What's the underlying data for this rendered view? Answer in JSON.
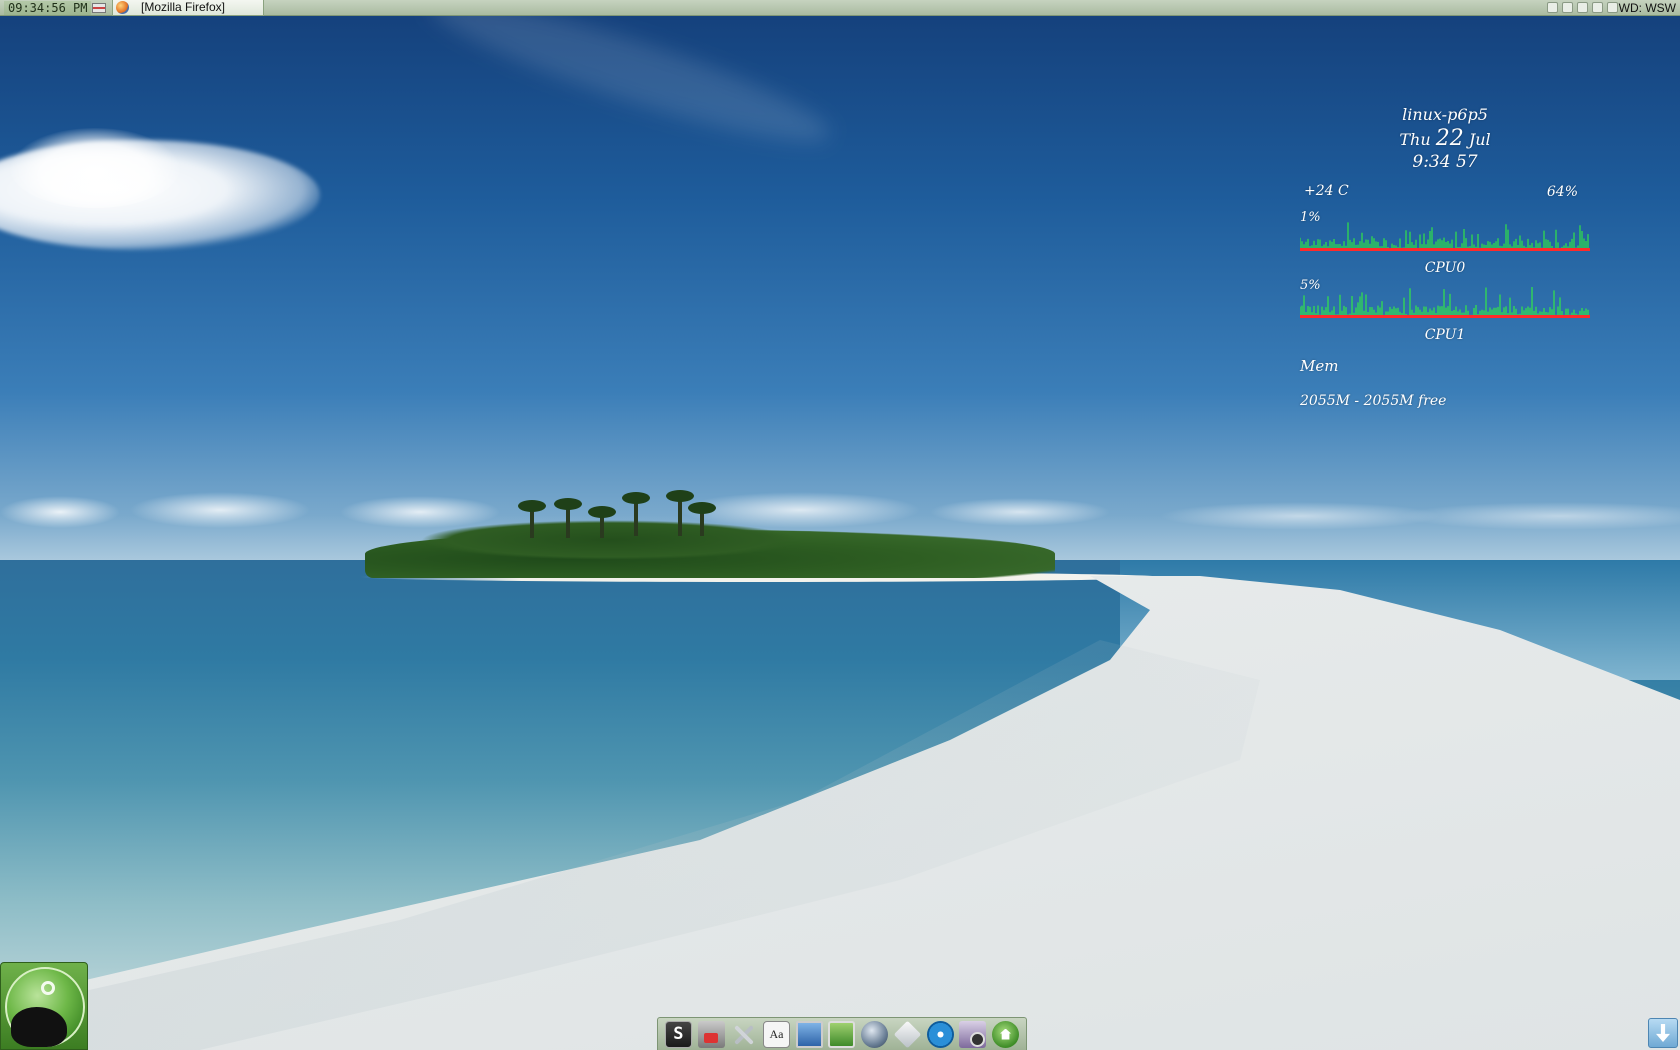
{
  "top_panel": {
    "clock": "09:34:56 PM",
    "taskbar": [
      {
        "label": "[Mozilla Firefox]",
        "icon": "firefox-icon"
      }
    ],
    "tray_icons": [
      "window-icon",
      "volume-icon",
      "network-icon",
      "battery-icon",
      "update-icon"
    ],
    "workspace": "WD: WSW"
  },
  "conky": {
    "hostname": "linux-p6p5",
    "date": {
      "weekday": "Thu",
      "day": "22",
      "month": "Jul"
    },
    "time": "9:34 57",
    "temperature": "+24 C",
    "battery": "64%",
    "cpu0": {
      "label": "CPU0",
      "percent": "1%"
    },
    "cpu1": {
      "label": "CPU1",
      "percent": "5%"
    },
    "memory": {
      "label": "Mem",
      "value": "2055M - 2055M free"
    },
    "colors": {
      "graph_low": "#ff2a2a",
      "graph_high": "#33ff33"
    }
  },
  "menu_button": {
    "icon": "xfce-mouse-icon"
  },
  "dock": {
    "items": [
      {
        "name": "terminal",
        "icon": "terminal-icon",
        "glyph": "S"
      },
      {
        "name": "network",
        "icon": "network-icon"
      },
      {
        "name": "settings",
        "icon": "tools-icon"
      },
      {
        "name": "fonts",
        "icon": "font-viewer-icon",
        "glyph": "Aa"
      },
      {
        "name": "display",
        "icon": "display-icon"
      },
      {
        "name": "monitor",
        "icon": "system-monitor-icon"
      },
      {
        "name": "planet",
        "icon": "planet-icon"
      },
      {
        "name": "diamond",
        "icon": "diamond-icon"
      },
      {
        "name": "disc",
        "icon": "disc-burner-icon"
      },
      {
        "name": "photos",
        "icon": "photo-viewer-icon"
      },
      {
        "name": "home",
        "icon": "home-folder-icon"
      }
    ]
  },
  "download_widget": {
    "icon": "download-arrow-icon"
  }
}
